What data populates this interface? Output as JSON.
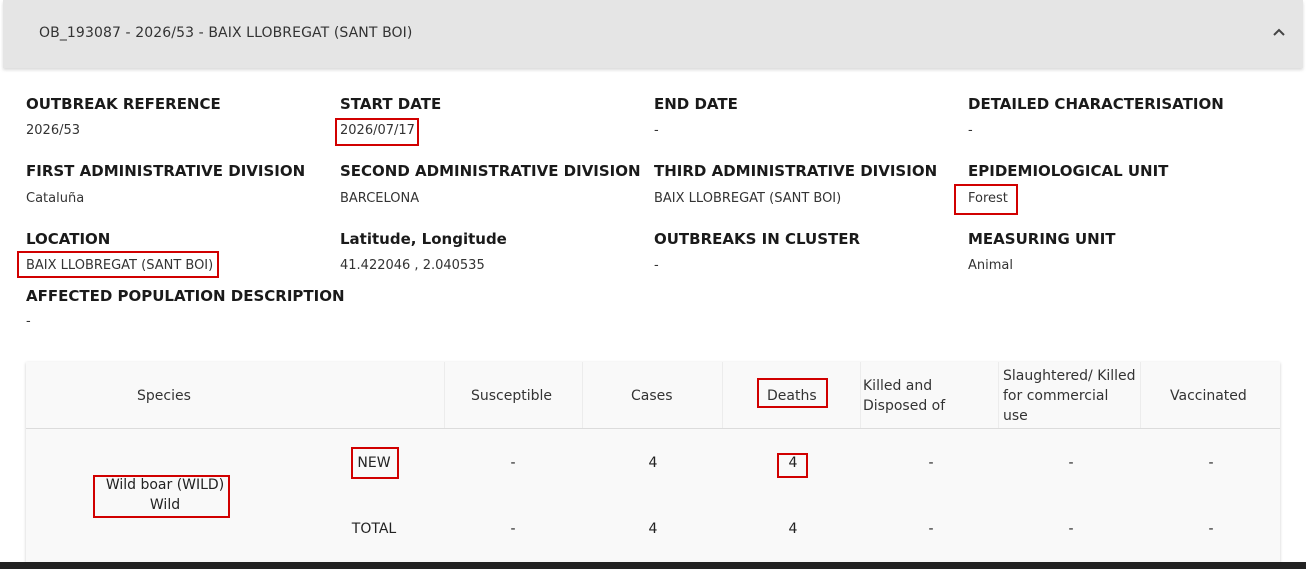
{
  "header": {
    "title": "OB_193087 - 2026/53 - BAIX LLOBREGAT (SANT BOI)",
    "chevron_icon": "chevron-up-icon"
  },
  "fields": {
    "outbreak_reference": {
      "label": "OUTBREAK REFERENCE",
      "value": "2026/53"
    },
    "start_date": {
      "label": "START DATE",
      "value": "2026/07/17"
    },
    "end_date": {
      "label": "END DATE",
      "value": "-"
    },
    "detailed_characterisation": {
      "label": "DETAILED CHARACTERISATION",
      "value": "-"
    },
    "first_admin": {
      "label": "FIRST ADMINISTRATIVE DIVISION",
      "value": "Cataluña"
    },
    "second_admin": {
      "label": "SECOND ADMINISTRATIVE DIVISION",
      "value": "BARCELONA"
    },
    "third_admin": {
      "label": "THIRD ADMINISTRATIVE DIVISION",
      "value": "BAIX LLOBREGAT (SANT BOI)"
    },
    "epi_unit": {
      "label": "EPIDEMIOLOGICAL UNIT",
      "value": "Forest"
    },
    "location": {
      "label": "LOCATION",
      "value": "BAIX LLOBREGAT (SANT BOI)"
    },
    "lat_long": {
      "label": "Latitude, Longitude",
      "value": "41.422046 , 2.040535"
    },
    "outbreaks_in_cluster": {
      "label": "OUTBREAKS IN CLUSTER",
      "value": "-"
    },
    "measuring_unit": {
      "label": "MEASURING UNIT",
      "value": "Animal"
    },
    "affected_population": {
      "label": "AFFECTED POPULATION DESCRIPTION",
      "value": "-"
    }
  },
  "table": {
    "headers": {
      "species": "Species",
      "susceptible": "Susceptible",
      "cases": "Cases",
      "deaths": "Deaths",
      "killed_line1": "Killed and",
      "killed_line2": "Disposed of",
      "slaughtered_line1": "Slaughtered/ Killed",
      "slaughtered_line2": "for commercial",
      "slaughtered_line3": "use",
      "vaccinated": "Vaccinated"
    },
    "species_line1": "Wild boar (WILD)",
    "species_line2": "Wild",
    "rows": [
      {
        "type": "NEW",
        "susceptible": "-",
        "cases": "4",
        "deaths": "4",
        "killed": "-",
        "slaughtered": "-",
        "vaccinated": "-"
      },
      {
        "type": "TOTAL",
        "susceptible": "-",
        "cases": "4",
        "deaths": "4",
        "killed": "-",
        "slaughtered": "-",
        "vaccinated": "-"
      }
    ]
  },
  "colors": {
    "highlight": "#d10000",
    "header_bg": "#e5e5e5",
    "table_bg": "#f9f9f9"
  }
}
